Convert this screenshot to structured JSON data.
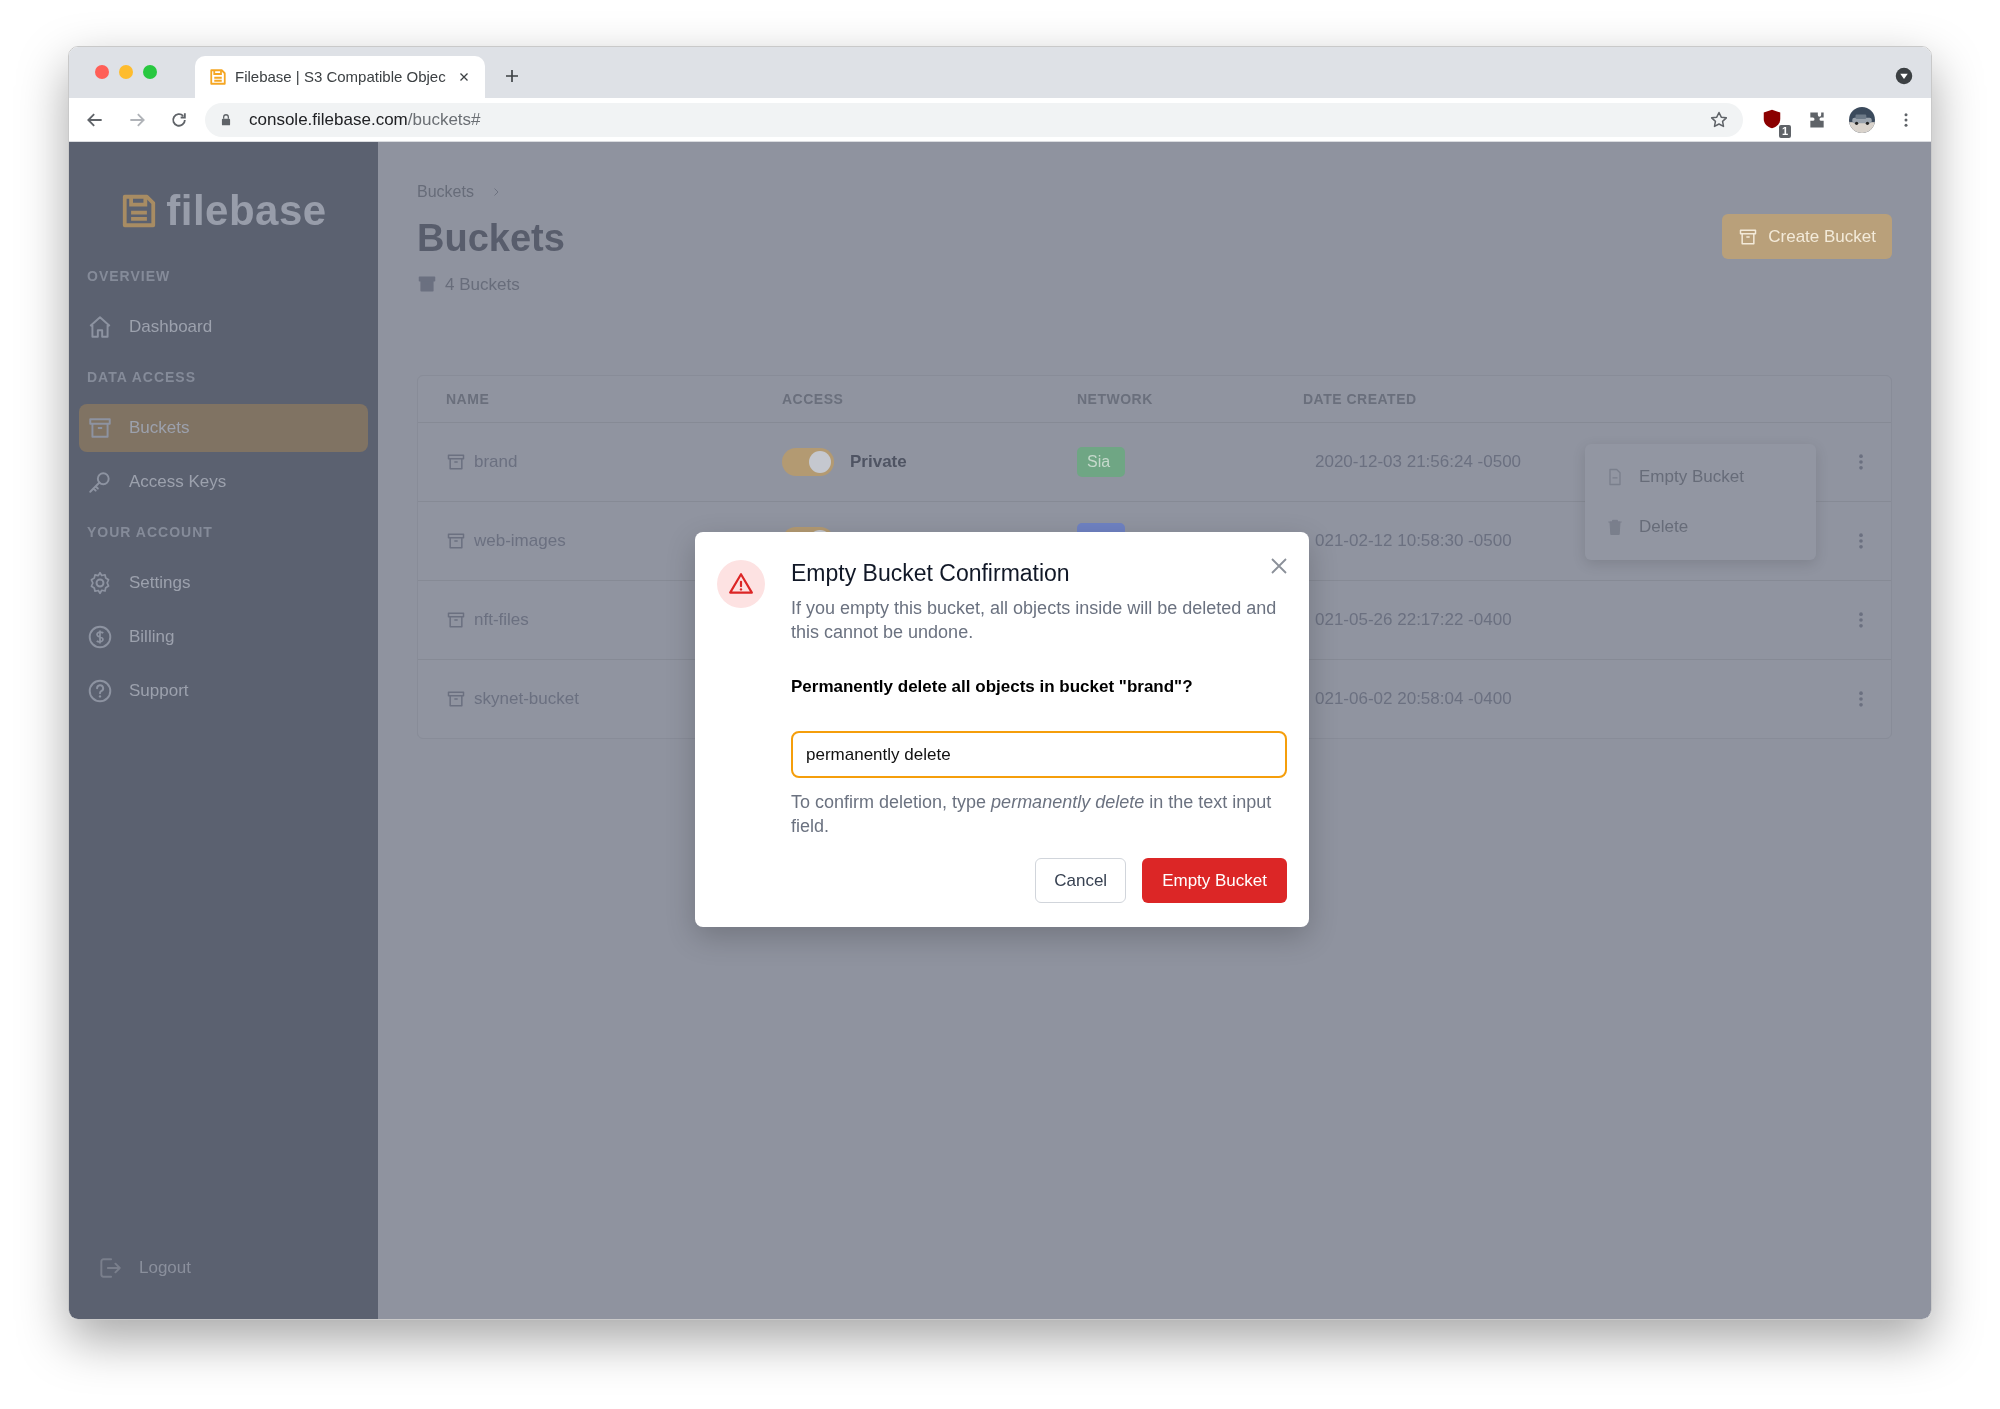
{
  "browser": {
    "tab_title": "Filebase | S3 Compatible Objec",
    "url": {
      "host": "console.filebase.com",
      "path": "/buckets#"
    },
    "extension_badge": "1"
  },
  "sidebar": {
    "logo_text": "filebase",
    "sections": [
      {
        "label": "OVERVIEW",
        "items": [
          {
            "label": "Dashboard",
            "selected": false
          }
        ]
      },
      {
        "label": "DATA ACCESS",
        "items": [
          {
            "label": "Buckets",
            "selected": true
          },
          {
            "label": "Access Keys",
            "selected": false
          }
        ]
      },
      {
        "label": "YOUR ACCOUNT",
        "items": [
          {
            "label": "Settings",
            "selected": false
          },
          {
            "label": "Billing",
            "selected": false
          },
          {
            "label": "Support",
            "selected": false
          }
        ]
      }
    ],
    "footer_item": {
      "label": "Logout"
    }
  },
  "page": {
    "breadcrumb": [
      "Buckets"
    ],
    "title": "Buckets",
    "count": "4 Buckets",
    "create_button": "Create Bucket"
  },
  "table": {
    "columns": [
      "NAME",
      "ACCESS",
      "NETWORK",
      "DATE CREATED"
    ],
    "rows": [
      {
        "name": "brand",
        "access": {
          "on": true,
          "label": "Private"
        },
        "network": {
          "label": "Sia",
          "color": "#6fa684"
        },
        "date": "2020-12-03 21:56:24 -0500"
      },
      {
        "name": "web-images",
        "access": {
          "on": true
        },
        "network": {
          "color": "#6f82c2"
        },
        "date": "021-02-12 10:58:30 -0500"
      },
      {
        "name": "nft-files",
        "date": "021-05-26 22:17:22 -0400"
      },
      {
        "name": "skynet-bucket",
        "date": "021-06-02 20:58:04 -0400"
      }
    ]
  },
  "row_menu": {
    "items": [
      "Empty Bucket",
      "Delete"
    ]
  },
  "modal": {
    "title": "Empty Bucket Confirmation",
    "message": "If you empty this bucket, all objects inside will be deleted and this cannot be undone.",
    "question": "Permanently delete all objects in bucket \"brand\"?",
    "input_value": "permanently delete",
    "help": "To confirm deletion, type *permanently delete* in the text input field.",
    "buttons": [
      {
        "label": "Cancel",
        "kind": "secondary"
      },
      {
        "label": "Empty Bucket",
        "kind": "danger"
      }
    ]
  }
}
